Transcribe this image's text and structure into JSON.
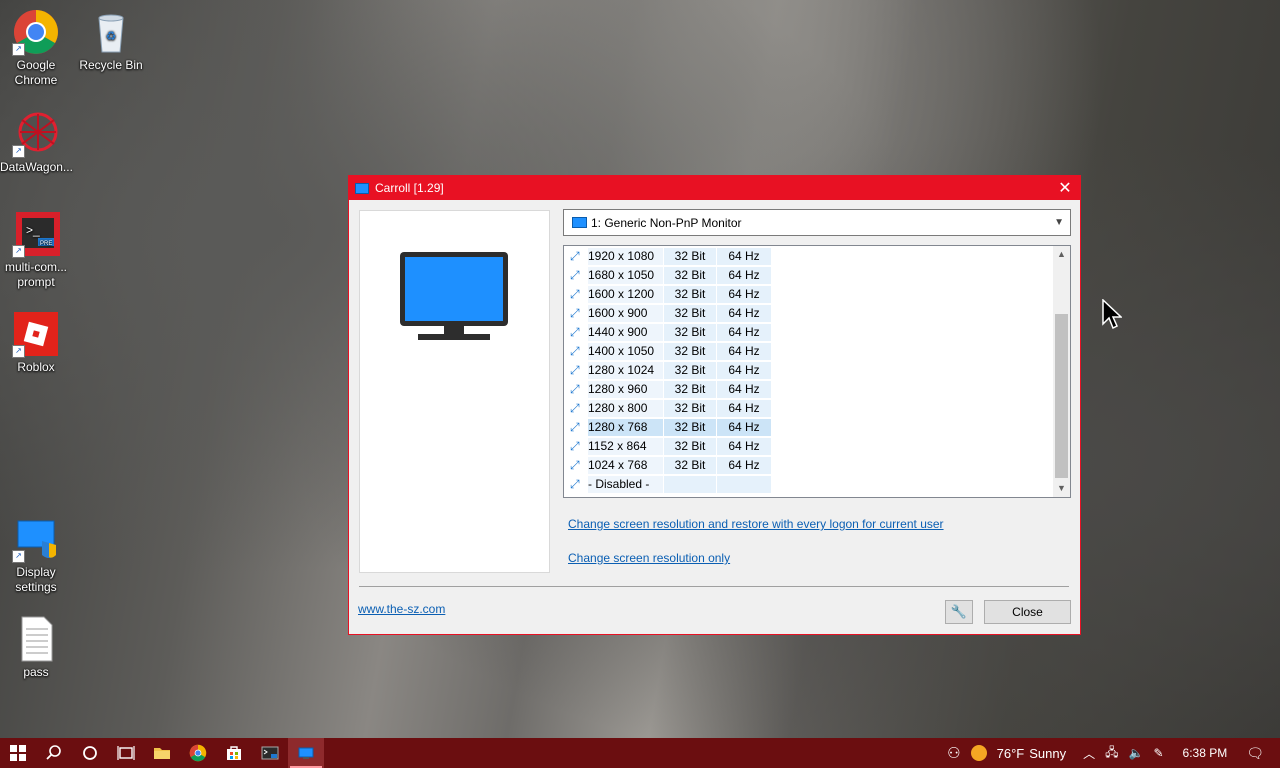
{
  "desktop": {
    "icons": [
      {
        "label": "Google Chrome",
        "icon": "chrome-icon"
      },
      {
        "label": "Recycle Bin",
        "icon": "recycle-bin-icon"
      },
      {
        "label": "DataWagon...",
        "icon": "datawagon-icon"
      },
      {
        "label": "multi-com... prompt",
        "icon": "terminal-icon"
      },
      {
        "label": "Roblox",
        "icon": "roblox-icon"
      },
      {
        "label": "Display settings",
        "icon": "display-settings-icon"
      },
      {
        "label": "pass",
        "icon": "text-file-icon"
      }
    ]
  },
  "dialog": {
    "title": "Carroll [1.29]",
    "monitor_select": "1: Generic Non-PnP Monitor",
    "modes": [
      {
        "res": "1920 x 1080",
        "bits": "32 Bit",
        "hz": "64 Hz"
      },
      {
        "res": "1680 x 1050",
        "bits": "32 Bit",
        "hz": "64 Hz"
      },
      {
        "res": "1600 x 1200",
        "bits": "32 Bit",
        "hz": "64 Hz"
      },
      {
        "res": "1600 x 900",
        "bits": "32 Bit",
        "hz": "64 Hz"
      },
      {
        "res": "1440 x 900",
        "bits": "32 Bit",
        "hz": "64 Hz"
      },
      {
        "res": "1400 x 1050",
        "bits": "32 Bit",
        "hz": "64 Hz"
      },
      {
        "res": "1280 x 1024",
        "bits": "32 Bit",
        "hz": "64 Hz"
      },
      {
        "res": "1280 x 960",
        "bits": "32 Bit",
        "hz": "64 Hz"
      },
      {
        "res": "1280 x 800",
        "bits": "32 Bit",
        "hz": "64 Hz"
      },
      {
        "res": "1280 x 768",
        "bits": "32 Bit",
        "hz": "64 Hz",
        "selected": true
      },
      {
        "res": "1152 x 864",
        "bits": "32 Bit",
        "hz": "64 Hz"
      },
      {
        "res": "1024 x 768",
        "bits": "32 Bit",
        "hz": "64 Hz"
      },
      {
        "res": "- Disabled -",
        "bits": "",
        "hz": ""
      }
    ],
    "link_restore": "Change screen resolution and restore with every logon for current user",
    "link_only": "Change screen resolution only",
    "website": "www.the-sz.com",
    "close_label": "Close"
  },
  "taskbar": {
    "weather_temp": "76°F",
    "weather_desc": "Sunny",
    "time": "6:38 PM"
  },
  "colors": {
    "accent": "#e81123",
    "taskbar": "#6b0e10",
    "link": "#0b5fb3",
    "selection": "#cce4f7"
  }
}
